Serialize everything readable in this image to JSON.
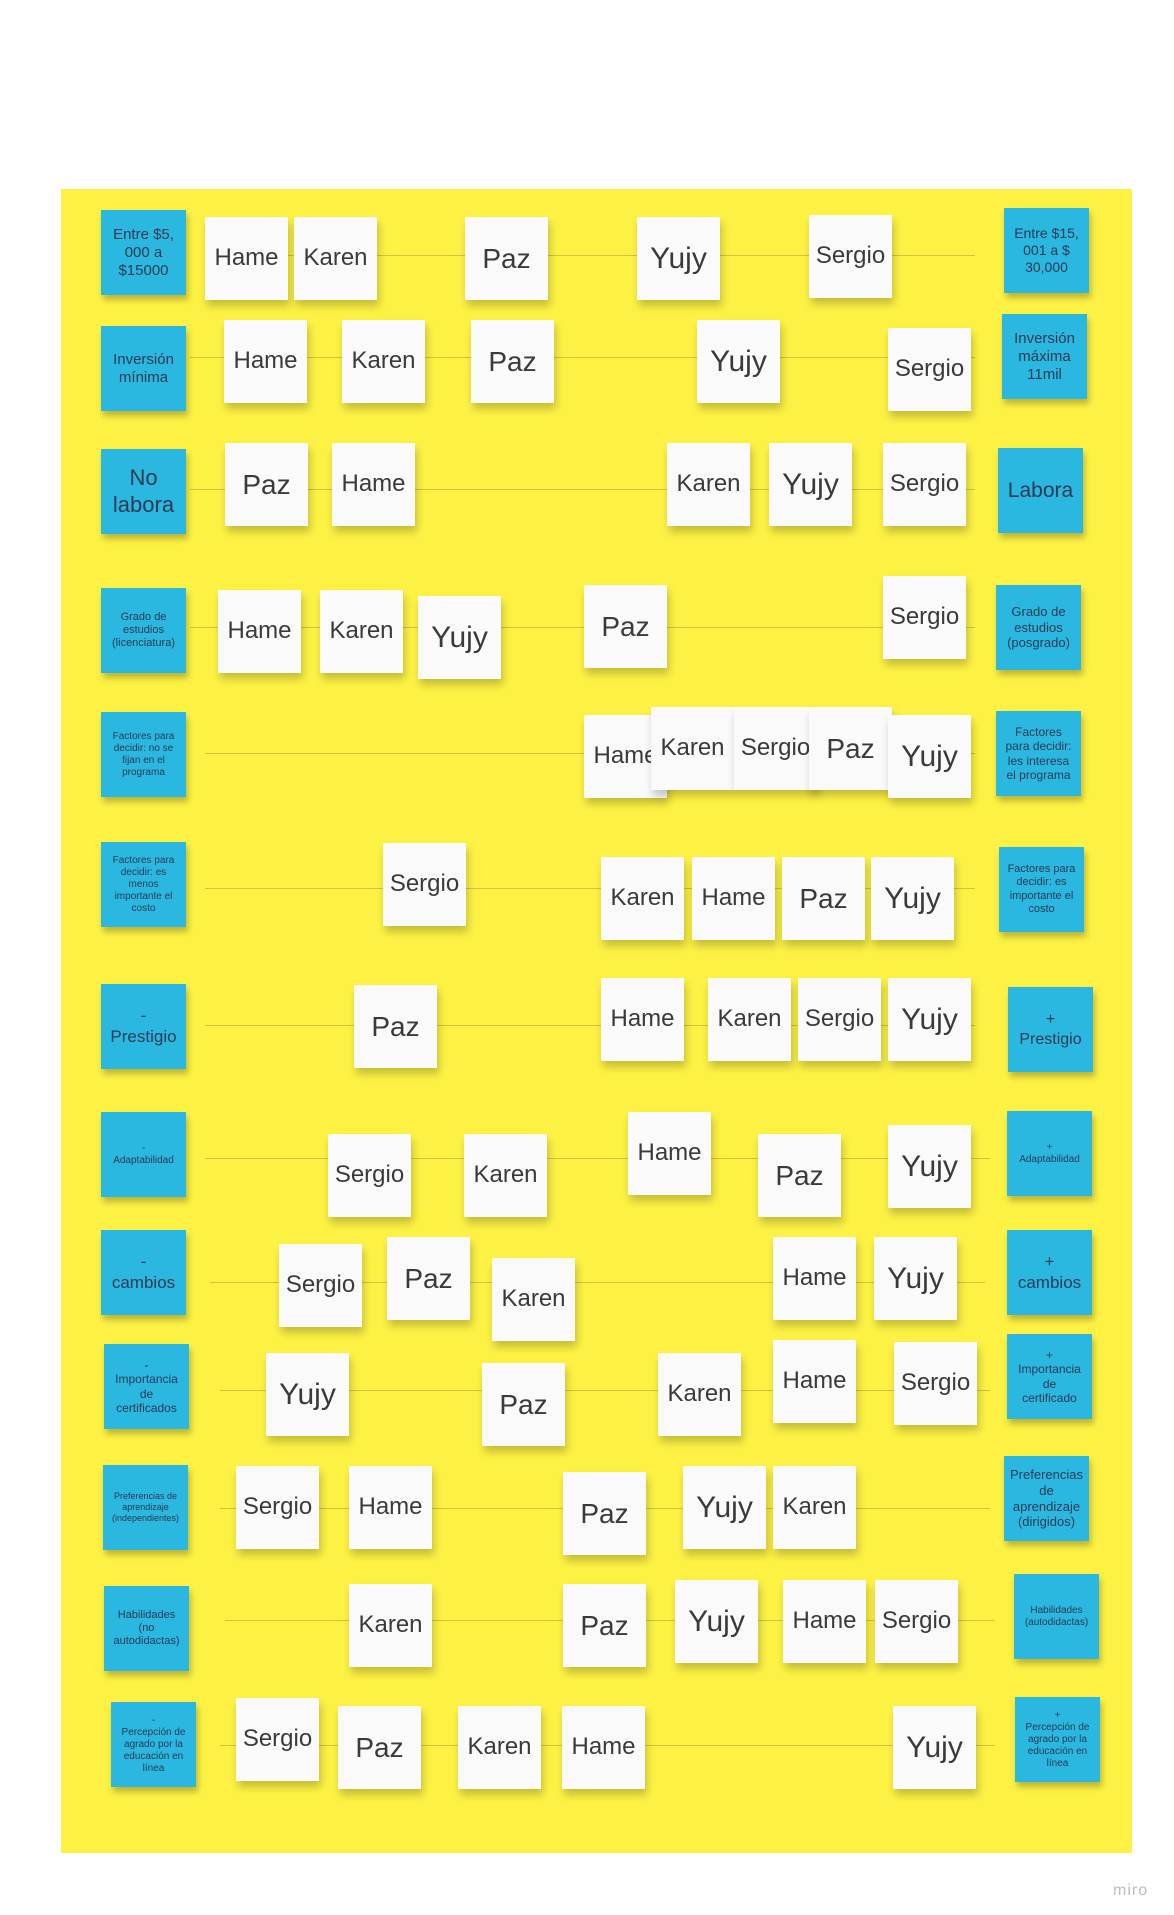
{
  "watermark": "miro",
  "colors": {
    "board": "#fdf244",
    "poles": "#2ab8e0",
    "names": "#fafafa"
  },
  "rows": [
    {
      "left": "Entre $5,\n000 a\n$15000",
      "right": "Entre $15,\n001 a $\n30,000",
      "names": [
        "Hame",
        "Karen",
        "Paz",
        "Yujy",
        "Sergio"
      ]
    },
    {
      "left": "Inversión\nmínima",
      "right": "Inversión\nmáxima\n11mil",
      "names": [
        "Hame",
        "Karen",
        "Paz",
        "Yujy",
        "Sergio"
      ]
    },
    {
      "left": "No\nlabora",
      "right": "Labora",
      "names": [
        "Paz",
        "Hame",
        "Karen",
        "Yujy",
        "Sergio"
      ]
    },
    {
      "left": "Grado de\nestudios\n(licenciatura)",
      "right": "Grado de\nestudios\n(posgrado)",
      "names": [
        "Hame",
        "Karen",
        "Yujy",
        "Paz",
        "Sergio"
      ]
    },
    {
      "left": "Factores para\ndecidir: no se\nfijan en el\nprograma",
      "right": "Factores\npara decidir:\nles interesa\nel programa",
      "names": [
        "Hame",
        "Karen",
        "Sergio",
        "Paz",
        "Yujy"
      ]
    },
    {
      "left": "Factores para\ndecidir: es\nmenos\nimportante el\ncosto",
      "right": "Factores para\ndecidir: es\nimportante el\ncosto",
      "names": [
        "Sergio",
        "Karen",
        "Hame",
        "Paz",
        "Yujy"
      ]
    },
    {
      "left": "-\nPrestigio",
      "right": "+\nPrestigio",
      "names": [
        "Paz",
        "Hame",
        "Karen",
        "Sergio",
        "Yujy"
      ]
    },
    {
      "left": "-\nAdaptabilidad",
      "right": "+\nAdaptabilidad",
      "names": [
        "Sergio",
        "Karen",
        "Hame",
        "Paz",
        "Yujy"
      ]
    },
    {
      "left": "-\ncambios",
      "right": "+\ncambios",
      "names": [
        "Sergio",
        "Paz",
        "Karen",
        "Hame",
        "Yujy"
      ]
    },
    {
      "left": "-\nImportancia\nde\ncertificados",
      "right": "+\nImportancia\nde\ncertificado",
      "names": [
        "Yujy",
        "Paz",
        "Karen",
        "Hame",
        "Sergio"
      ]
    },
    {
      "left": "Preferencias de\naprendizaje\n(independientes)",
      "right": "Preferencias\nde\naprendizaje\n(dirigidos)",
      "names": [
        "Sergio",
        "Hame",
        "Paz",
        "Yujy",
        "Karen"
      ]
    },
    {
      "left": "Habilidades\n(no\nautodidactas)",
      "right": "Habilidades\n(autodidactas)",
      "names": [
        "Karen",
        "Paz",
        "Yujy",
        "Hame",
        "Sergio"
      ]
    },
    {
      "left": "-\nPercepción de\nagrado por la\neducación en\nlínea",
      "right": "+\nPercepción de\nagrado por la\neducación en\nlínea",
      "names": [
        "Sergio",
        "Paz",
        "Karen",
        "Hame",
        "Yujy"
      ]
    }
  ]
}
